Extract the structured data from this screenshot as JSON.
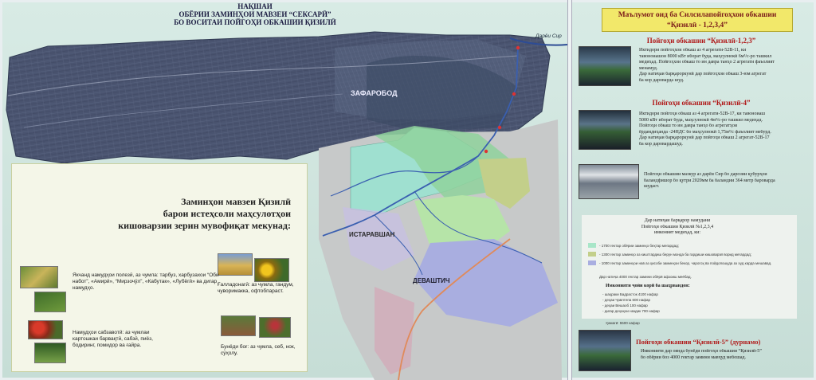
{
  "map": {
    "title_lines": [
      "НАҚШАИ",
      "ОБЁРИИ ЗАМИНҲОИ МАВЗЕИ “СЕКСАРӢ”",
      "БО ВОСИТАИ ПОЙГОҲИ ОБКАШИИ ҚИЗИЛӢ"
    ],
    "place_labels": {
      "zafarobod": "ЗАФАРОБОД",
      "istaravshan": "ИСТАРАВШАН",
      "devashtich": "ДЕВАШТИЧ",
      "river": "Дарёи Сир"
    },
    "colors": {
      "farmland_dark": "#47506a",
      "zone_green": "#8fd29c",
      "zone_teal": "#9fe0d0",
      "zone_olive": "#c3cf8a",
      "zone_purple": "#a9aee0",
      "zone_lightgreen": "#b6e4a8",
      "zone_grey": "#c7c9c9",
      "river": "#3a5fb0"
    }
  },
  "info_box": {
    "heading_lines": [
      "Заминҳои мавзеи Қизилӣ",
      "барои истеҳсоли маҳсулотҳои",
      "кишоварзии зерин мувофиқат мекунад:"
    ],
    "crops": {
      "melons": "Якчанд намудҳои полезӣ, аз чумла: тарбуз, харбузахои “Оби набот”, «Амирӣ», “Мирзочӯл”, «Кабутак», «Лубёгӣ» ва дигар намудҳо.",
      "grains": "Ғалладонагӣ: аз чумла, гандум, чуворимакка, офтобпараст.",
      "vegetables": "Намудҳои сабзавотӣ: аз чумлаи картошкаи барвақтӣ, сабзӣ, пиёз, бодиринг, помидор ва ғайра.",
      "orchards": "Бунёди боғ: аз чумла, себ, нок, сӯҳолу."
    }
  },
  "right_panel": {
    "title_lines": [
      "Маълумот оид ба Силсилапойгоҳхои обкашии",
      "“Қизилӣ - 1,2,3,4”"
    ],
    "station_123": {
      "title": "Пойгоҳи обкашии “Қизилӣ-1,2,3”",
      "lines": [
        "Иктидори пойгоҳхои обкаш аз 4 агрегати-52В-11, ки",
        "тавоноиашон 8000 кВт иборат буда, маҳсулнокӣ 6м³/с-ро ташкил",
        "медиҳад. Пойгоҳхои обкаш то ин давра танҳо 2 агрегати фаъолият",
        "менамуд.",
        "Дар натиҷаи барқароркунӣ дар пойгоҳхои обкаш 3-юм агрегат",
        "ба кор дароварда шуд."
      ]
    },
    "station_4": {
      "title": "Пойгоҳи обкашии “Қизилӣ-4”",
      "lines": [
        "Иктидори пойгоҳи обкаш аз 4 агрегати-52В-17, ки тавоноиаш",
        "5000 кВт иборат буда, маҳсулнокӣ 4м³/с-ро ташкил медиҳад.",
        "Пойгоҳи обкаш то ин давра танҳо бо агрегатҳои",
        "ёрдамдиҳанда -24НДС бо маҳсулнокӣ 1,75м³/с фаъолият мебурд.",
        "Дар натиҷаи барқароркунӣ дар пойгоҳи обкаш 2 агрегат-52В-17",
        "ба кор даровардашуд."
      ]
    },
    "pipeline": {
      "lines": [
        "Пойгоҳи обкашии мазкур аз дарёи Сир бо дарозии қубурҳои",
        "баландфишор бо қутри 2020мм ба баландии 364 метр бароварда",
        "шудаст."
      ]
    },
    "results": {
      "heading_lines": [
        "Дар натиҷаи барқарор намудани",
        "Пойгоҳи обкашии Қизилӣ №1,2,3,4",
        "имконият медиҳад, ки:"
      ],
      "legend": [
        "- 1700 гектар обёрии заминҳо беҳтар мегардад;",
        "- 1300 гектар заминҳо аз киштгардиш берун монда ба гардиши кишоварзӣ ворид мегардад;",
        "- 1000 гектар заминҳои нав аз ҳисоби заминҳои бекор, чарогоҳ ва пойдопошуда аз худ карда мешавад."
      ],
      "legend_colors": [
        "#a8e6c8",
        "#c3cf8a",
        "#a9aee0"
      ],
      "water_line": "Дар натиҷа 4000 гектар замини обёрӣ афзоиш меёбад.",
      "jobs_heading": "Имконияти ҷойи корӣ ба шаҳрвандон:",
      "jobs": [
        "- шаҳраки Бадрасток 4100 нафар",
        "- деҳаи Ҷавлтепа 600 нафар",
        "- деҳаи Вешаоб 100 нафар",
        "- дигар деҳаҳои наздик 700 нафар"
      ],
      "jobs_total": "Ҳамагӣ: 5500 нафар"
    },
    "station_5": {
      "title": "Пойгоҳи обкашии “Қизилӣ-5” (дурнамо)",
      "lines": [
        "Имконияти дар оянда бунёди пойгоҳи обкашии “Қизилӣ-5”",
        "бо обёрии боз 4000 гектар замини мавҷуд мебошад."
      ]
    }
  }
}
